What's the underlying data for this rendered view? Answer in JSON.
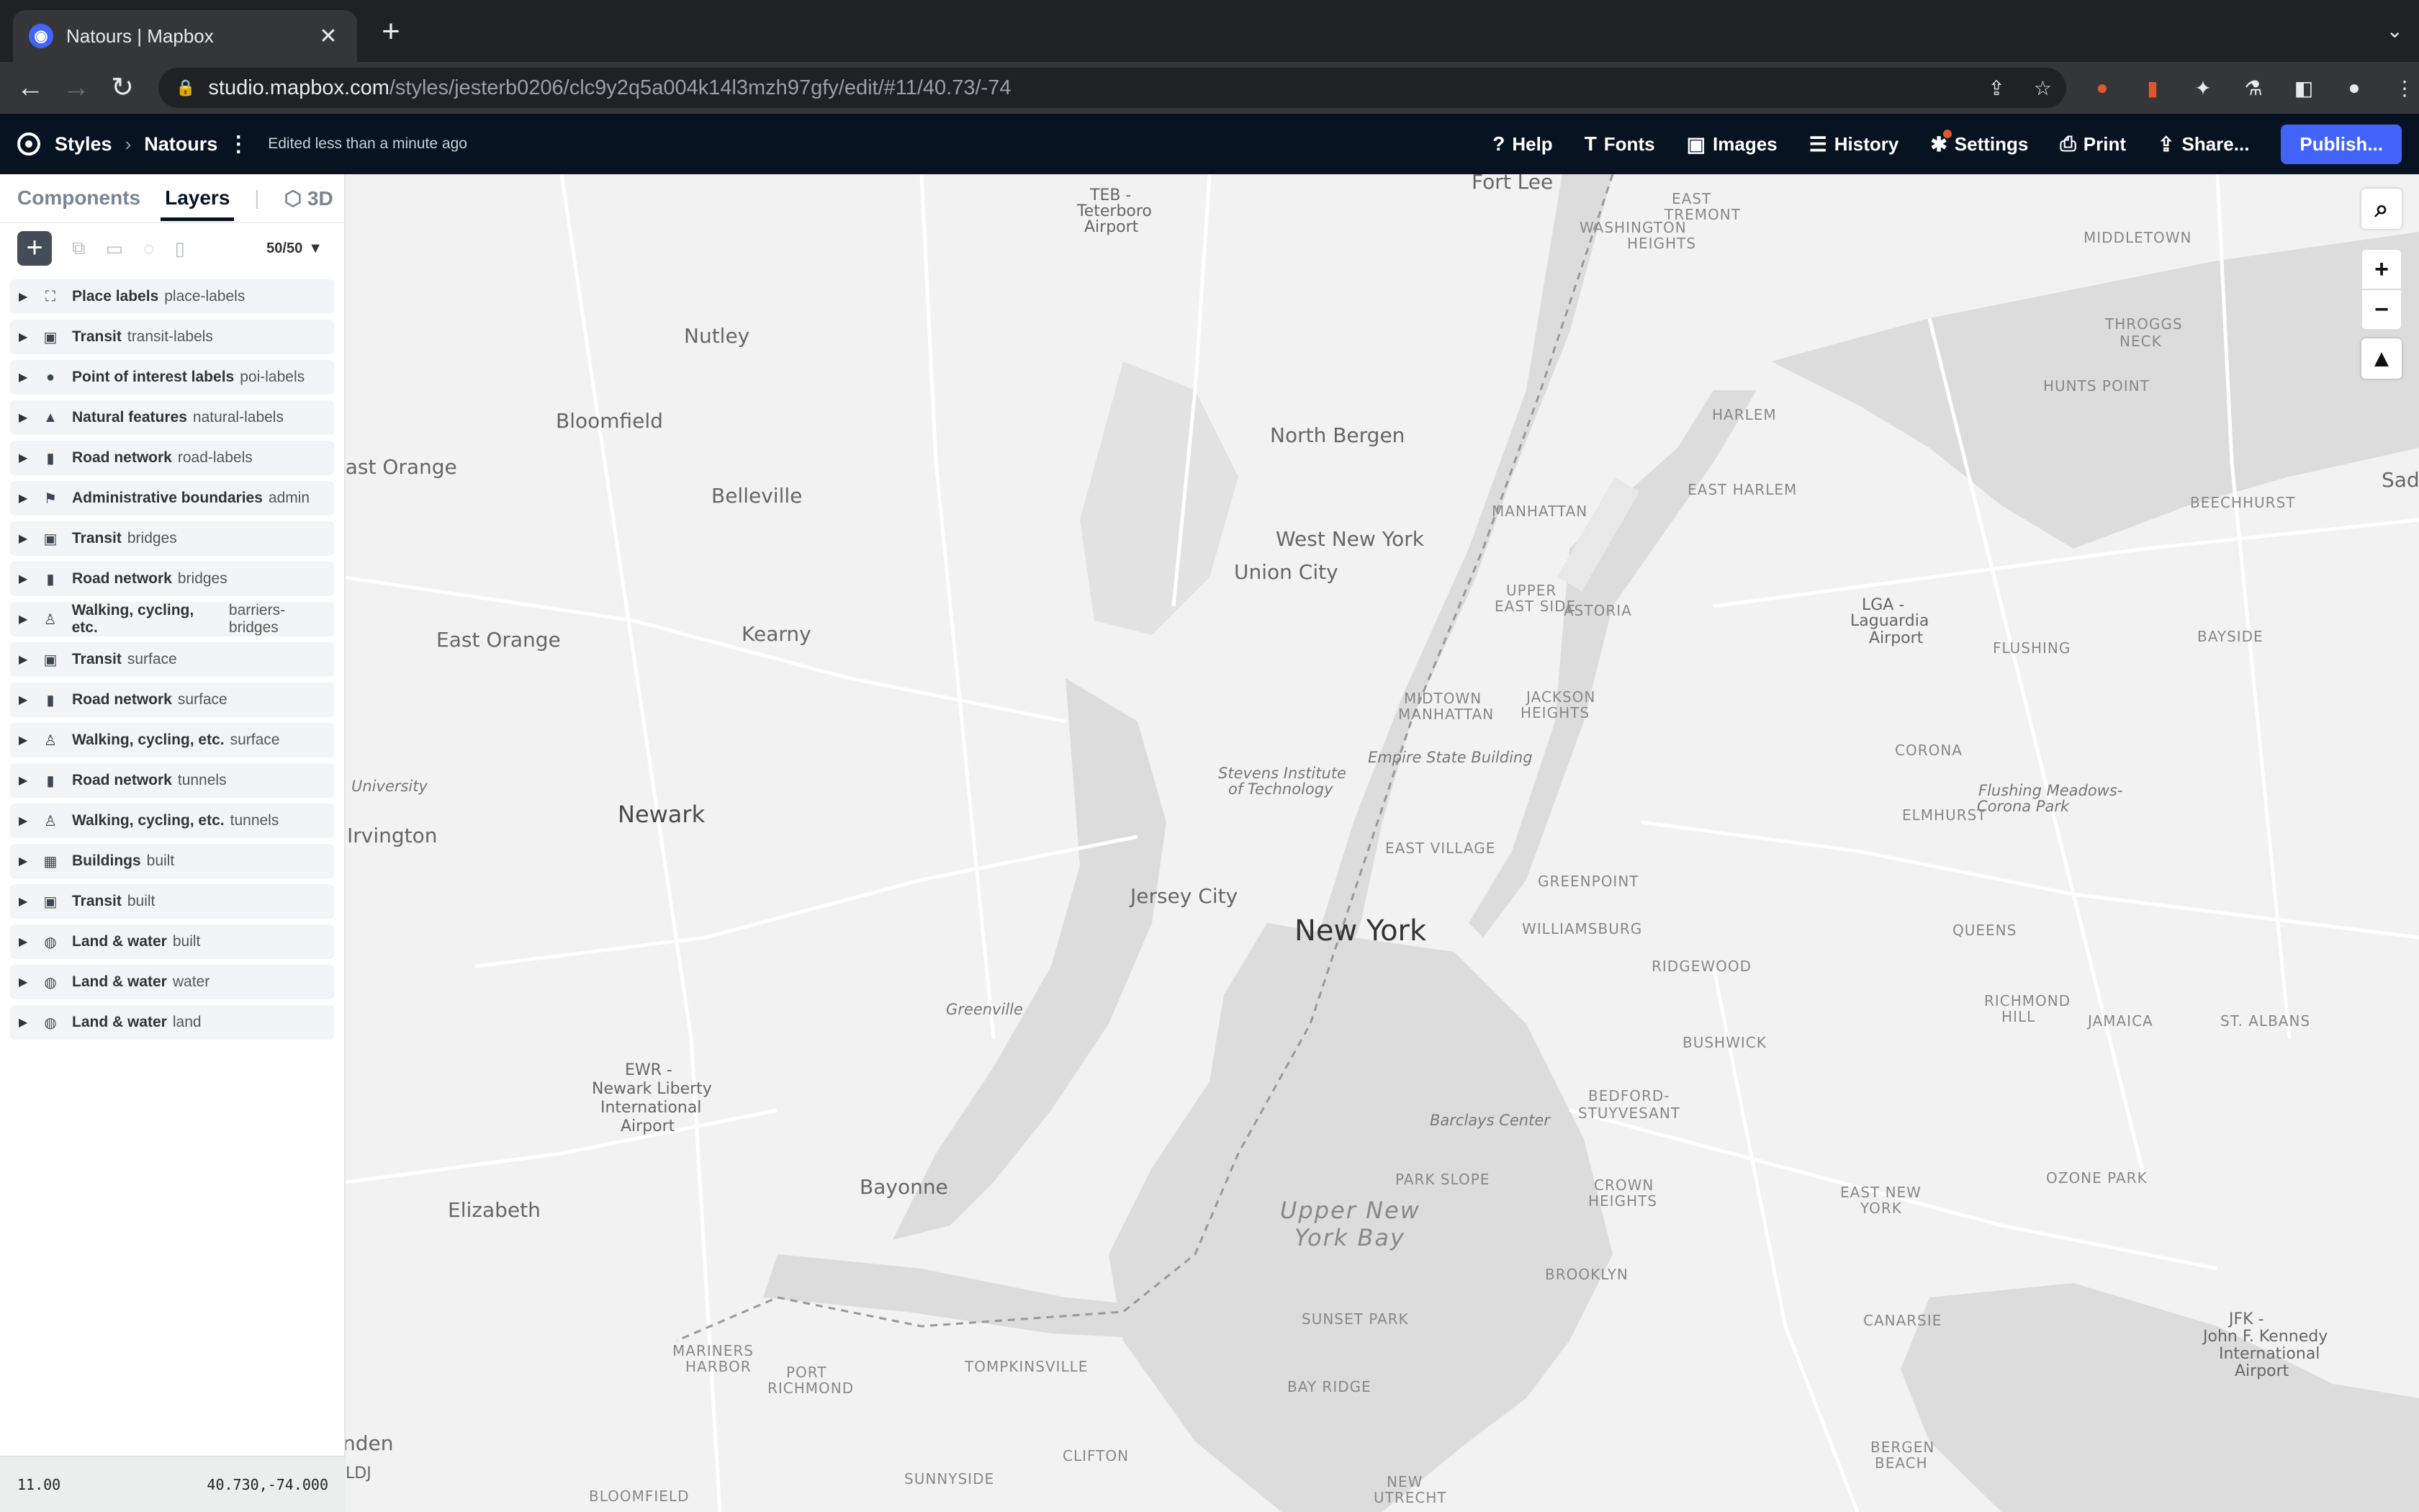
{
  "browser": {
    "tab_title": "Natours | Mapbox",
    "tab_favicon": "mapbox-logo-icon",
    "url_host": "studio.mapbox.com",
    "url_path": "/styles/jesterb0206/clc9y2q5a004k14l3mzh97gfy/edit/#11/40.73/-74"
  },
  "app": {
    "crumb_styles": "Styles",
    "crumb_style_name": "Natours",
    "edited": "Edited less than a minute ago",
    "nav": {
      "help": "Help",
      "fonts": "Fonts",
      "images": "Images",
      "history": "History",
      "settings": "Settings",
      "print": "Print",
      "share": "Share...",
      "publish": "Publish..."
    },
    "accent_color": "#4264fb"
  },
  "sidebar": {
    "tabs": {
      "components": "Components",
      "layers": "Layers",
      "threed": "3D"
    },
    "count": "50/50",
    "layers": [
      {
        "name": "Place labels",
        "group": "place-labels",
        "icon": "place-labels-icon"
      },
      {
        "name": "Transit",
        "group": "transit-labels",
        "icon": "transit-icon"
      },
      {
        "name": "Point of interest labels",
        "group": "poi-labels",
        "icon": "pin-icon"
      },
      {
        "name": "Natural features",
        "group": "natural-labels",
        "icon": "mountain-icon"
      },
      {
        "name": "Road network",
        "group": "road-labels",
        "icon": "road-icon"
      },
      {
        "name": "Administrative boundaries",
        "group": "admin",
        "icon": "flag-icon"
      },
      {
        "name": "Transit",
        "group": "bridges",
        "icon": "transit-icon"
      },
      {
        "name": "Road network",
        "group": "bridges",
        "icon": "road-icon"
      },
      {
        "name": "Walking, cycling, etc.",
        "group": "barriers-bridges",
        "icon": "walking-icon"
      },
      {
        "name": "Transit",
        "group": "surface",
        "icon": "transit-icon"
      },
      {
        "name": "Road network",
        "group": "surface",
        "icon": "road-icon"
      },
      {
        "name": "Walking, cycling, etc.",
        "group": "surface",
        "icon": "walking-icon"
      },
      {
        "name": "Road network",
        "group": "tunnels",
        "icon": "road-icon"
      },
      {
        "name": "Walking, cycling, etc.",
        "group": "tunnels",
        "icon": "walking-icon"
      },
      {
        "name": "Buildings",
        "group": "built",
        "icon": "building-icon"
      },
      {
        "name": "Transit",
        "group": "built",
        "icon": "transit-icon"
      },
      {
        "name": "Land & water",
        "group": "built",
        "icon": "globe-icon"
      },
      {
        "name": "Land & water",
        "group": "water",
        "icon": "globe-icon"
      },
      {
        "name": "Land & water",
        "group": "land",
        "icon": "globe-icon"
      }
    ],
    "zoom": "11.00",
    "coords": "40.730,-74.000"
  },
  "map": {
    "labels": [
      {
        "text": "TEB -",
        "cls": "air"
      },
      {
        "text": "Teterboro",
        "cls": "air"
      },
      {
        "text": "Airport",
        "cls": "air"
      },
      {
        "text": "Fort Lee",
        "cls": "town"
      },
      {
        "text": "EAST",
        "cls": "hood"
      },
      {
        "text": "TREMONT",
        "cls": "hood"
      },
      {
        "text": "WASHINGTON",
        "cls": "hood"
      },
      {
        "text": "HEIGHTS",
        "cls": "hood"
      },
      {
        "text": "MIDDLETOWN",
        "cls": "hood"
      },
      {
        "text": "Nutley",
        "cls": "town"
      },
      {
        "text": "THROGGS",
        "cls": "hood"
      },
      {
        "text": "NECK",
        "cls": "hood"
      },
      {
        "text": "HUNTS POINT",
        "cls": "hood"
      },
      {
        "text": "Bloomfield",
        "cls": "town"
      },
      {
        "text": "North Bergen",
        "cls": "town"
      },
      {
        "text": "HARLEM",
        "cls": "hood"
      },
      {
        "text": "East Orange",
        "cls": "town"
      },
      {
        "text": "Belleville",
        "cls": "town"
      },
      {
        "text": "EAST HARLEM",
        "cls": "hood"
      },
      {
        "text": "BEECHHURST",
        "cls": "hood"
      },
      {
        "text": "MANHATTAN",
        "cls": "hood"
      },
      {
        "text": "West New York",
        "cls": "town"
      },
      {
        "text": "Union City",
        "cls": "town"
      },
      {
        "text": "UPPER",
        "cls": "hood"
      },
      {
        "text": "EAST SIDE",
        "cls": "hood"
      },
      {
        "text": "ASTORIA",
        "cls": "hood"
      },
      {
        "text": "LGA -",
        "cls": "air"
      },
      {
        "text": "Laguardia",
        "cls": "air"
      },
      {
        "text": "Airport",
        "cls": "air"
      },
      {
        "text": "East Orange",
        "cls": "town"
      },
      {
        "text": "Kearny",
        "cls": "town"
      },
      {
        "text": "BAYSIDE",
        "cls": "hood"
      },
      {
        "text": "FLUSHING",
        "cls": "hood"
      },
      {
        "text": "MIDTOWN",
        "cls": "hood"
      },
      {
        "text": "MANHATTAN",
        "cls": "hood"
      },
      {
        "text": "JACKSON",
        "cls": "hood"
      },
      {
        "text": "HEIGHTS",
        "cls": "hood"
      },
      {
        "text": "Empire State Building",
        "cls": "poi"
      },
      {
        "text": "CORONA",
        "cls": "hood"
      },
      {
        "text": "Stevens Institute",
        "cls": "poi"
      },
      {
        "text": "of Technology",
        "cls": "poi"
      },
      {
        "text": "University",
        "cls": "poi"
      },
      {
        "text": "Flushing Meadows-",
        "cls": "poi"
      },
      {
        "text": "Corona Park",
        "cls": "poi"
      },
      {
        "text": "ELMHURST",
        "cls": "hood"
      },
      {
        "text": "Newark",
        "cls": "city"
      },
      {
        "text": "Irvington",
        "cls": "town"
      },
      {
        "text": "EAST VILLAGE",
        "cls": "hood"
      },
      {
        "text": "GREENPOINT",
        "cls": "hood"
      },
      {
        "text": "Jersey City",
        "cls": "town"
      },
      {
        "text": "New York",
        "cls": "big"
      },
      {
        "text": "WILLIAMSBURG",
        "cls": "hood"
      },
      {
        "text": "QUEENS",
        "cls": "hood"
      },
      {
        "text": "RIDGEWOOD",
        "cls": "hood"
      },
      {
        "text": "Greenville",
        "cls": "poi"
      },
      {
        "text": "RICHMOND",
        "cls": "hood"
      },
      {
        "text": "HILL",
        "cls": "hood"
      },
      {
        "text": "JAMAICA",
        "cls": "hood"
      },
      {
        "text": "ST. ALBANS",
        "cls": "hood"
      },
      {
        "text": "BUSHWICK",
        "cls": "hood"
      },
      {
        "text": "EWR -",
        "cls": "air"
      },
      {
        "text": "Newark Liberty",
        "cls": "air"
      },
      {
        "text": "International",
        "cls": "air"
      },
      {
        "text": "Airport",
        "cls": "air"
      },
      {
        "text": "BEDFORD-",
        "cls": "hood"
      },
      {
        "text": "STUYVESANT",
        "cls": "hood"
      },
      {
        "text": "Barclays Center",
        "cls": "poi"
      },
      {
        "text": "PARK SLOPE",
        "cls": "hood"
      },
      {
        "text": "CROWN",
        "cls": "hood"
      },
      {
        "text": "HEIGHTS",
        "cls": "hood"
      },
      {
        "text": "EAST NEW",
        "cls": "hood"
      },
      {
        "text": "YORK",
        "cls": "hood"
      },
      {
        "text": "OZONE PARK",
        "cls": "hood"
      },
      {
        "text": "Bayonne",
        "cls": "town"
      },
      {
        "text": "Elizabeth",
        "cls": "town"
      },
      {
        "text": "Upper New",
        "cls": "water"
      },
      {
        "text": "York Bay",
        "cls": "water"
      },
      {
        "text": "BROOKLYN",
        "cls": "hood"
      },
      {
        "text": "SUNSET PARK",
        "cls": "hood"
      },
      {
        "text": "CANARSIE",
        "cls": "hood"
      },
      {
        "text": "JFK -",
        "cls": "air"
      },
      {
        "text": "John F. Kennedy",
        "cls": "air"
      },
      {
        "text": "International",
        "cls": "air"
      },
      {
        "text": "Airport",
        "cls": "air"
      },
      {
        "text": "MARINERS",
        "cls": "hood"
      },
      {
        "text": "HARBOR",
        "cls": "hood"
      },
      {
        "text": "PORT",
        "cls": "hood"
      },
      {
        "text": "RICHMOND",
        "cls": "hood"
      },
      {
        "text": "TOMPKINSVILLE",
        "cls": "hood"
      },
      {
        "text": "BAY RIDGE",
        "cls": "hood"
      },
      {
        "text": "CLIFTON",
        "cls": "hood"
      },
      {
        "text": "BERGEN",
        "cls": "hood"
      },
      {
        "text": "BEACH",
        "cls": "hood"
      },
      {
        "text": "SUNNYSIDE",
        "cls": "hood"
      },
      {
        "text": "NEW",
        "cls": "hood"
      },
      {
        "text": "UTRECHT",
        "cls": "hood"
      },
      {
        "text": "BLOOMFIELD",
        "cls": "hood"
      },
      {
        "text": "nden",
        "cls": "town"
      },
      {
        "text": "LDJ",
        "cls": "air"
      },
      {
        "text": "Sadd",
        "cls": "town"
      }
    ]
  }
}
